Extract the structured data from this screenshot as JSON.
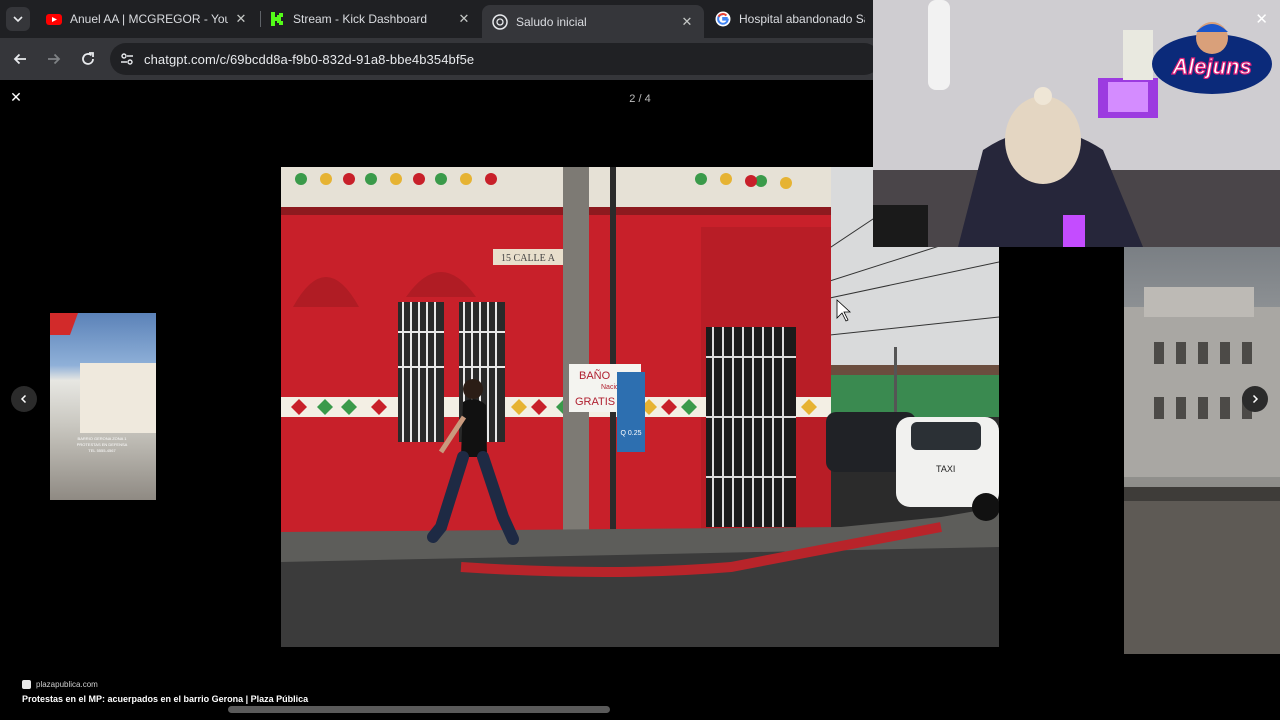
{
  "browser": {
    "tabs": [
      {
        "title": "Anuel AA | MCGREGOR - YouTube",
        "favicon": "youtube-icon",
        "active": false
      },
      {
        "title": "Stream - Kick Dashboard",
        "favicon": "kick-icon",
        "active": false
      },
      {
        "title": "Saludo inicial",
        "favicon": "chatgpt-icon",
        "active": true
      },
      {
        "title": "Hospital abandonado San V",
        "favicon": "google-icon",
        "active": false
      }
    ],
    "tab_close_glyph": "✕",
    "url": "chatgpt.com/c/69bcdd8a-f9b0-832d-91a8-bbe4b354bf5e"
  },
  "viewer": {
    "close_glyph": "✕",
    "counter": "2 / 4",
    "source_domain": "plazapublica.com",
    "caption": "Protestas en el MP: acuerpados en el barrio Gerona | Plaza Pública",
    "prev_icon": "chevron-left-icon",
    "next_icon": "chevron-right-icon"
  },
  "photo": {
    "street_sign": "15 CALLE A",
    "poster_line1": "BAÑO",
    "poster_line2": "Nacional",
    "poster_line3": "GRATIS",
    "blue_sign": "Q 0.25",
    "taxi_text": "TAXI"
  },
  "thumb_left": {
    "sign_lines": [
      "BARRIO GERONA ZONA 1",
      "PROTESTAS EN DEFENSA",
      "TEL 5555-4567"
    ]
  },
  "overlay": {
    "logo_text": "Alejuns",
    "close_glyph": "✕"
  },
  "colors": {
    "tab_bar": "#1f2023",
    "toolbar": "#35363a",
    "omnibox": "#202124",
    "wall_red": "#c8202a"
  }
}
